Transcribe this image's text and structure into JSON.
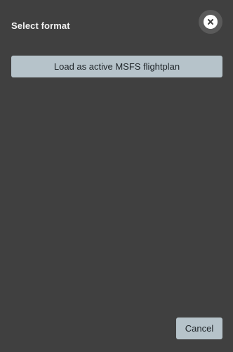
{
  "dialog": {
    "title": "Select format",
    "close_icon": "close-circle-icon",
    "options": [
      {
        "label": "Load as active MSFS flightplan"
      }
    ],
    "cancel_label": "Cancel"
  },
  "colors": {
    "background": "#404040",
    "button": "#b6c3ca",
    "button_text": "#1e2428",
    "title_text": "#f2f2f2",
    "close_bg": "#5a5a5a"
  }
}
